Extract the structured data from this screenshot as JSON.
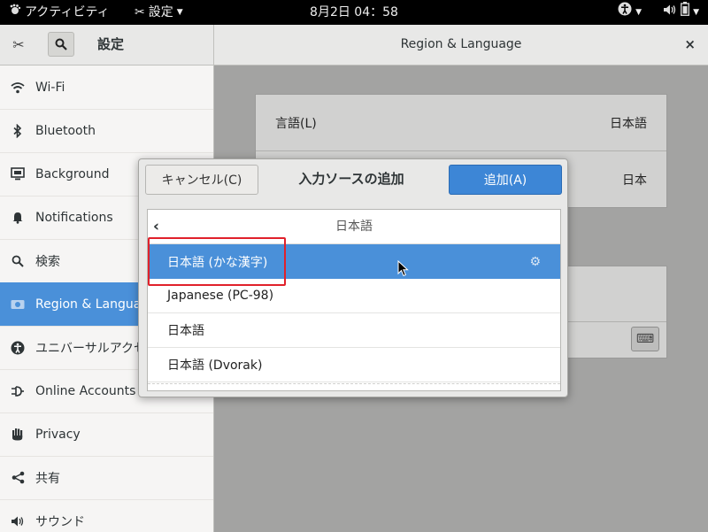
{
  "topbar": {
    "activities": "アクティビティ",
    "app_menu": "設定",
    "clock": "8月2日  04：58",
    "icons": [
      "accessibility-icon",
      "volume-icon",
      "battery-icon",
      "power-menu-icon"
    ]
  },
  "header": {
    "settings_title": "設定",
    "panel_title": "Region & Language",
    "close_label": "×"
  },
  "sidebar": {
    "items": [
      {
        "label": "Wi-Fi",
        "icon": "wifi-icon"
      },
      {
        "label": "Bluetooth",
        "icon": "bluetooth-icon"
      },
      {
        "label": "Background",
        "icon": "background-icon"
      },
      {
        "label": "Notifications",
        "icon": "bell-icon"
      },
      {
        "label": "検索",
        "icon": "search-icon"
      },
      {
        "label": "Region & Language",
        "icon": "region-icon",
        "selected": true
      },
      {
        "label": "ユニバーサルアクセス",
        "icon": "accessibility-icon"
      },
      {
        "label": "Online Accounts",
        "icon": "online-accounts-icon"
      },
      {
        "label": "Privacy",
        "icon": "hand-icon"
      },
      {
        "label": "共有",
        "icon": "share-icon"
      },
      {
        "label": "サウンド",
        "icon": "sound-icon"
      }
    ]
  },
  "main": {
    "language_label": "言語(L)",
    "language_value": "日本語",
    "formats_value": "日本"
  },
  "dialog": {
    "title": "入力ソースの追加",
    "cancel_label": "キャンセル(C)",
    "add_label": "追加(A)",
    "list_header": "日本語",
    "items": [
      {
        "label": "日本語 (かな漢字)",
        "selected": true,
        "has_settings": true
      },
      {
        "label": "Japanese (PC-98)"
      },
      {
        "label": "日本語"
      },
      {
        "label": "日本語 (Dvorak)"
      }
    ]
  },
  "colors": {
    "accent": "#4a90d9",
    "highlight_box": "#e0212b"
  }
}
